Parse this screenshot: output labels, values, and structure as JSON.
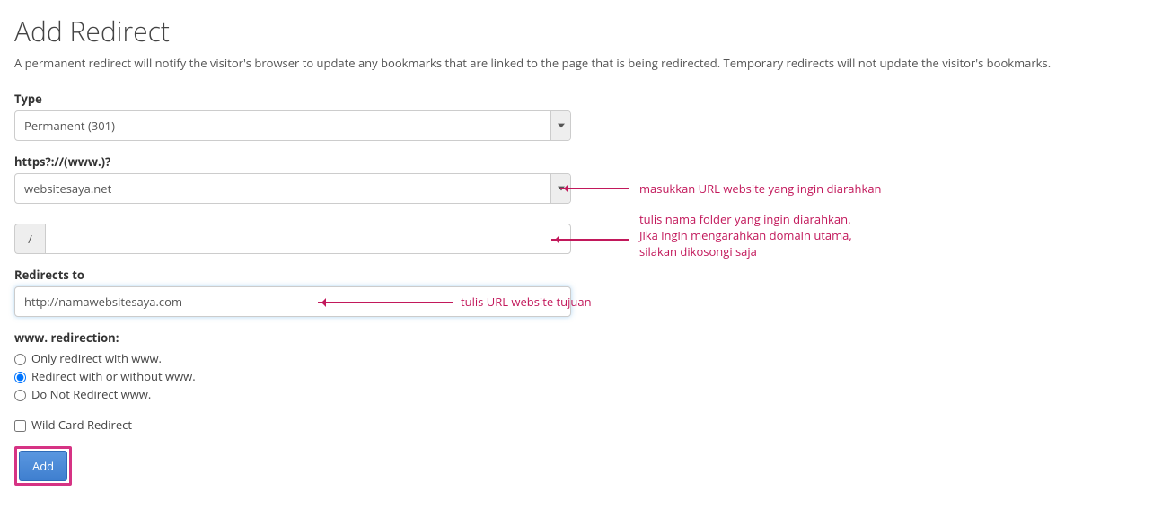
{
  "title": "Add Redirect",
  "description": "A permanent redirect will notify the visitor's browser to update any bookmarks that are linked to the page that is being redirected. Temporary redirects will not update the visitor's bookmarks.",
  "type": {
    "label": "Type",
    "value": "Permanent (301)"
  },
  "domain": {
    "label": "https?://(www.)?",
    "value": "websitesaya.net",
    "annotation": "masukkan URL website yang ingin diarahkan"
  },
  "path": {
    "prefix": "/",
    "value": "",
    "annotation_line1": "tulis nama folder yang ingin diarahkan.",
    "annotation_line2": "Jika ingin mengarahkan domain utama,",
    "annotation_line3": "silakan dikosongi saja"
  },
  "redirects_to": {
    "label": "Redirects to",
    "value": "http://namawebsitesaya.com",
    "annotation": "tulis URL website tujuan"
  },
  "www": {
    "label": "www. redirection:",
    "options": [
      "Only redirect with www.",
      "Redirect with or without www.",
      "Do Not Redirect www."
    ],
    "selected_index": 1
  },
  "wildcard": {
    "label": "Wild Card Redirect",
    "checked": false
  },
  "add_button": "Add"
}
